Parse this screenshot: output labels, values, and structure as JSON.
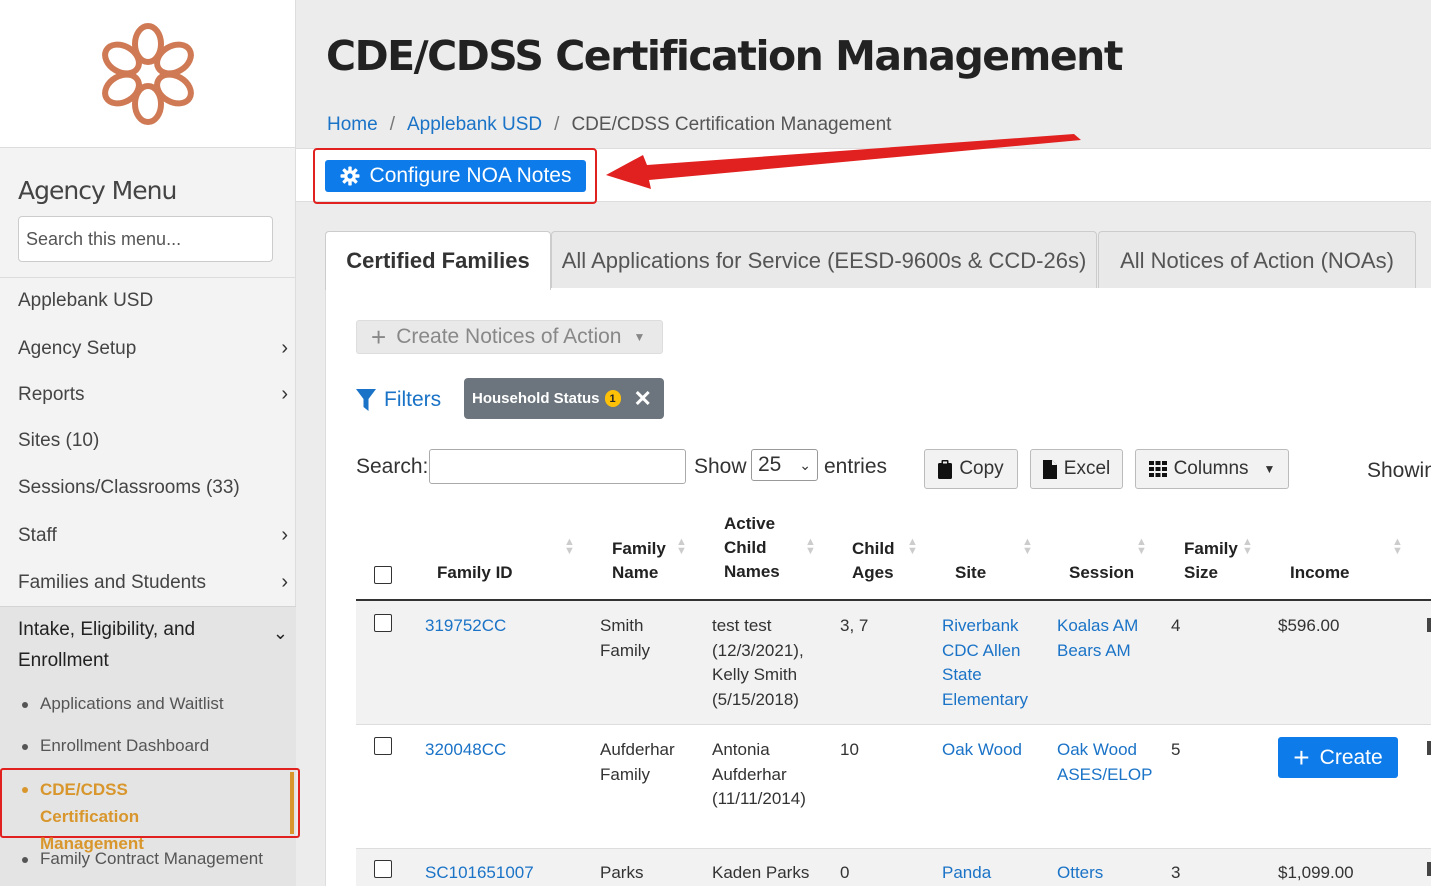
{
  "sidebar": {
    "menu_title": "Agency Menu",
    "search_placeholder": "Search this menu...",
    "items": [
      {
        "label": "Applebank USD",
        "has_children": false
      },
      {
        "label": "Agency Setup",
        "has_children": true
      },
      {
        "label": "Reports",
        "has_children": true
      },
      {
        "label": "Sites (10)",
        "has_children": false
      },
      {
        "label": "Sessions/Classrooms (33)",
        "has_children": false
      },
      {
        "label": "Staff",
        "has_children": true
      },
      {
        "label": "Families and Students",
        "has_children": true
      }
    ],
    "expanded_section": "Intake, Eligibility, and Enrollment",
    "sub_items": [
      {
        "label": "Applications and Waitlist"
      },
      {
        "label": "Enrollment Dashboard"
      },
      {
        "label": "CDE/CDSS Certification Management",
        "active": true
      },
      {
        "label": "Family Contract Management"
      }
    ],
    "accent_color": "#d8962c"
  },
  "header": {
    "title": "CDE/CDSS Certification Management",
    "breadcrumb": [
      "Home",
      "Applebank USD",
      "CDE/CDSS Certification Management"
    ]
  },
  "toolbar": {
    "configure_label": "Configure NOA Notes",
    "primary_color": "#0d7bea",
    "highlight_color": "#e1211f"
  },
  "tabs": [
    {
      "label": "Certified Families",
      "active": true
    },
    {
      "label": "All Applications for Service (EESD-9600s & CCD-26s)",
      "active": false
    },
    {
      "label": "All Notices of Action (NOAs)",
      "active": false
    }
  ],
  "actions": {
    "create_noa_label": "Create Notices of Action",
    "filters_label": "Filters",
    "filter_chip": {
      "label": "Household Status",
      "count": "1"
    }
  },
  "table_controls": {
    "search_label": "Search:",
    "show_label": "Show",
    "entries_value": "25",
    "entries_label": "entries",
    "copy_label": "Copy",
    "excel_label": "Excel",
    "columns_label": "Columns",
    "showing_text": "Showing"
  },
  "table": {
    "headers": [
      "Family ID",
      "Family Name",
      "Active Child Names",
      "Child Ages",
      "Site",
      "Session",
      "Family Size",
      "Income"
    ],
    "rows": [
      {
        "family_id": "319752CC",
        "family_name": "Smith Family",
        "child_names": "test test (12/3/2021), Kelly Smith (5/15/2018)",
        "child_ages": "3, 7",
        "site": "Riverbank CDC Allen State Elementary",
        "session": "Koalas AM Bears AM",
        "family_size": "4",
        "income": "$596.00"
      },
      {
        "family_id": "320048CC",
        "family_name": "Aufderhar Family",
        "child_names": "Antonia Aufderhar (11/11/2014)",
        "child_ages": "10",
        "site": "Oak Wood",
        "session": "Oak Wood ASES/ELOP",
        "family_size": "5",
        "income": "",
        "action_label": "Create"
      },
      {
        "family_id": "SC101651007",
        "family_name": "Parks",
        "child_names": "Kaden Parks",
        "child_ages": "0",
        "site": "Panda",
        "session": "Otters",
        "family_size": "3",
        "income": "$1,099.00"
      }
    ]
  }
}
